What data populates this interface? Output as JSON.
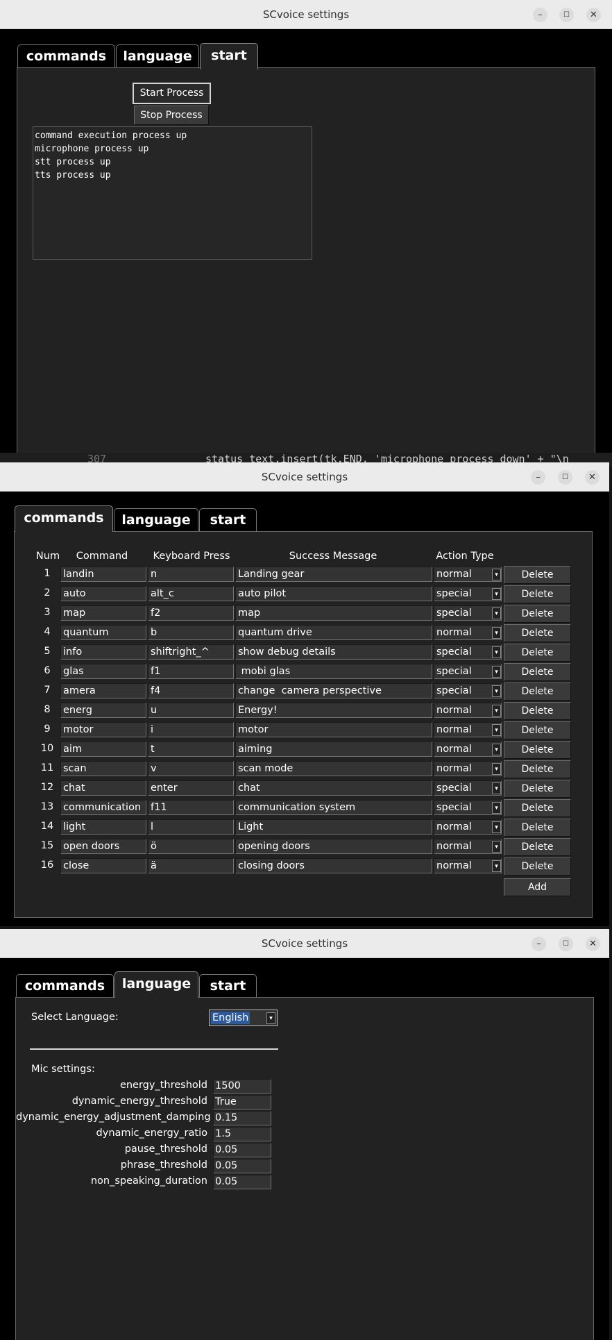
{
  "app_title": "SCvoice settings",
  "tabs": [
    "commands",
    "language",
    "start"
  ],
  "start_tab": {
    "start_button": "Start Process",
    "stop_button": "Stop Process",
    "status_lines": [
      "command execution process up",
      "microphone process up",
      "stt process up",
      "tts process up"
    ]
  },
  "background_code": {
    "line_number": "307",
    "text": "status_text.insert(tk.END, 'microphone process down' + \"\\n"
  },
  "commands_tab": {
    "headers": {
      "num": "Num",
      "command": "Command",
      "keyboard": "Keyboard Press",
      "message": "Success Message",
      "action": "Action Type"
    },
    "rows": [
      {
        "num": "1",
        "command": "landin",
        "key": "n",
        "message": "Landing gear",
        "action": "normal"
      },
      {
        "num": "2",
        "command": "auto",
        "key": "alt_c",
        "message": "auto pilot",
        "action": "special"
      },
      {
        "num": "3",
        "command": "map",
        "key": "f2",
        "message": "map",
        "action": "special"
      },
      {
        "num": "4",
        "command": "quantum",
        "key": "b",
        "message": "quantum drive",
        "action": "normal"
      },
      {
        "num": "5",
        "command": "info",
        "key": "shiftright_^",
        "message": "show debug details",
        "action": "special"
      },
      {
        "num": "6",
        "command": "glas",
        "key": "f1",
        "message": " mobi glas",
        "action": "special"
      },
      {
        "num": "7",
        "command": "amera",
        "key": "f4",
        "message": "change  camera perspective",
        "action": "special"
      },
      {
        "num": "8",
        "command": "energ",
        "key": "u",
        "message": "Energy!",
        "action": "normal"
      },
      {
        "num": "9",
        "command": "motor",
        "key": "i",
        "message": "motor",
        "action": "normal"
      },
      {
        "num": "10",
        "command": "aim",
        "key": "t",
        "message": "aiming",
        "action": "normal"
      },
      {
        "num": "11",
        "command": "scan",
        "key": "v",
        "message": "scan mode",
        "action": "normal"
      },
      {
        "num": "12",
        "command": "chat",
        "key": "enter",
        "message": "chat",
        "action": "special"
      },
      {
        "num": "13",
        "command": "communication",
        "key": "f11",
        "message": "communication system",
        "action": "special"
      },
      {
        "num": "14",
        "command": "light",
        "key": "l",
        "message": "Light",
        "action": "normal"
      },
      {
        "num": "15",
        "command": "open doors",
        "key": "ö",
        "message": "opening doors",
        "action": "normal"
      },
      {
        "num": "16",
        "command": "close",
        "key": "ä",
        "message": "closing doors",
        "action": "normal"
      }
    ],
    "delete_label": "Delete",
    "add_label": "Add"
  },
  "language_tab": {
    "select_label": "Select Language:",
    "selected_language": "English",
    "mic_label": "Mic settings:",
    "settings": [
      {
        "name": "energy_threshold",
        "value": "1500"
      },
      {
        "name": "dynamic_energy_threshold",
        "value": "True"
      },
      {
        "name": "dynamic_energy_adjustment_damping",
        "value": "0.15"
      },
      {
        "name": "dynamic_energy_ratio",
        "value": "1.5"
      },
      {
        "name": "pause_threshold",
        "value": "0.05"
      },
      {
        "name": "phrase_threshold",
        "value": "0.05"
      },
      {
        "name": "non_speaking_duration",
        "value": "0.05"
      }
    ]
  },
  "colors": {
    "background": "#232323",
    "titlebar": "#ebebeb",
    "selection": "#2b5a9e"
  }
}
